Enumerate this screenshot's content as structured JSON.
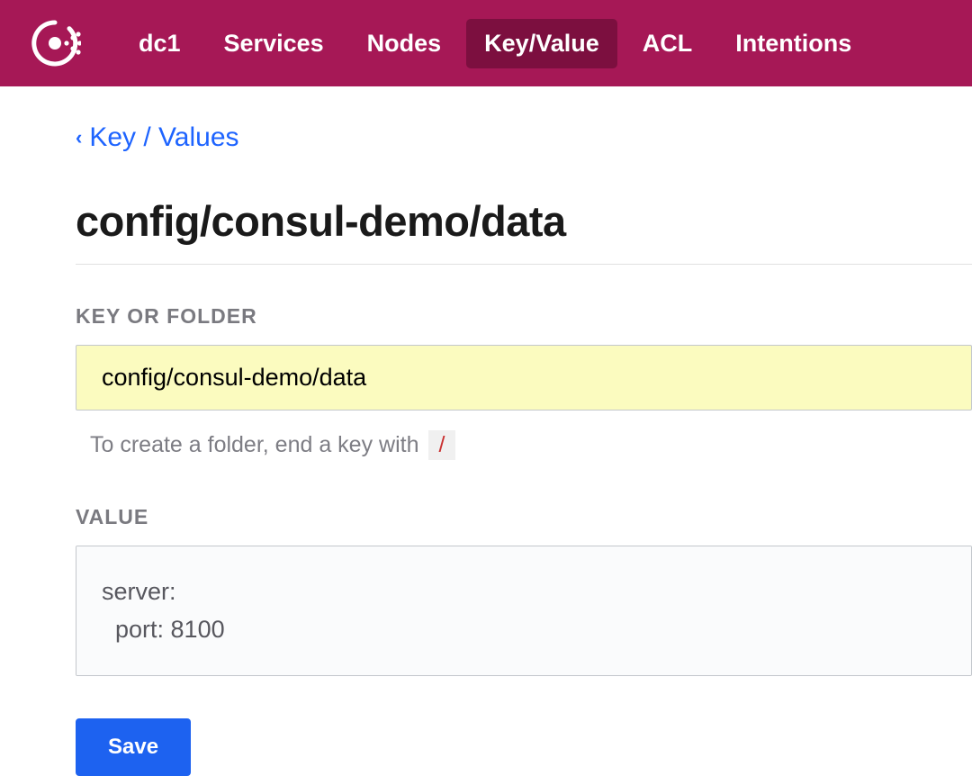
{
  "nav": {
    "datacenter": "dc1",
    "items": [
      {
        "label": "Services",
        "active": false
      },
      {
        "label": "Nodes",
        "active": false
      },
      {
        "label": "Key/Value",
        "active": true
      },
      {
        "label": "ACL",
        "active": false
      },
      {
        "label": "Intentions",
        "active": false
      }
    ]
  },
  "breadcrumb": {
    "caret": "‹",
    "link": "Key / Values"
  },
  "page": {
    "title": "config/consul-demo/data"
  },
  "form": {
    "key_label": "KEY OR FOLDER",
    "key_value": "config/consul-demo/data",
    "hint_text": "To create a folder, end a key with",
    "hint_code": "/",
    "value_label": "VALUE",
    "value_content": "server:\n  port: 8100",
    "save_label": "Save"
  }
}
